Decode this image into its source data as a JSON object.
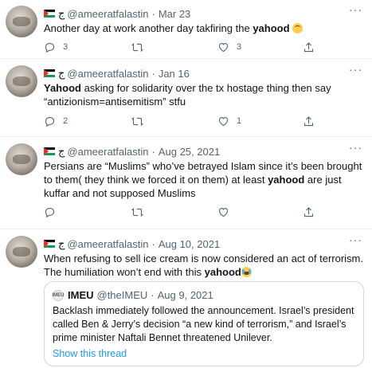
{
  "tweets": [
    {
      "name_glyph": "ج",
      "handle": "@ameeratfalastin",
      "date": "Mar 23",
      "text_parts": [
        "Another day at work another day takfiring the ",
        "yahood",
        " "
      ],
      "replies": "3",
      "retweets": "",
      "likes": "3"
    },
    {
      "name_glyph": "ج",
      "handle": "@ameeratfalastin",
      "date": "Jan 16",
      "text_parts": [
        "Yahood",
        " asking for solidarity over the tx hostage thing then say “antizionism=antisemitism” stfu"
      ],
      "replies": "2",
      "retweets": "",
      "likes": "1"
    },
    {
      "name_glyph": "ج",
      "handle": "@ameeratfalastin",
      "date": "Aug 25, 2021",
      "text_parts": [
        "Persians are “Muslims” who’ve betrayed Islam since it’s been brought to them( they think we forced it on them) at least ",
        "yahood",
        " are just kuffar and not supposed Muslims"
      ],
      "replies": "",
      "retweets": "",
      "likes": ""
    },
    {
      "name_glyph": "ج",
      "handle": "@ameeratfalastin",
      "date": "Aug 10, 2021",
      "text_parts": [
        "When refusing to sell ice cream is now considered an act of terrorism. The humiliation won’t end with this ",
        "yahood"
      ],
      "quote": {
        "logo_text": "IMEU",
        "name": "IMEU",
        "handle": "@theIMEU",
        "date": "Aug 9, 2021",
        "text": "Backlash immediately followed the announcement. Israel’s president called Ben & Jerry’s decision “a new kind of terrorism,” and Israel’s prime minister Naftali Bennet threatened Unilever.",
        "link": "Show this thread"
      }
    }
  ],
  "header": {
    "separator": "·",
    "more": "···"
  },
  "icons": [
    "reply-icon",
    "retweet-icon",
    "like-icon",
    "share-icon"
  ],
  "colors": {
    "link": "#1d9bf0",
    "muted": "#536471",
    "border": "#eff3f4"
  }
}
